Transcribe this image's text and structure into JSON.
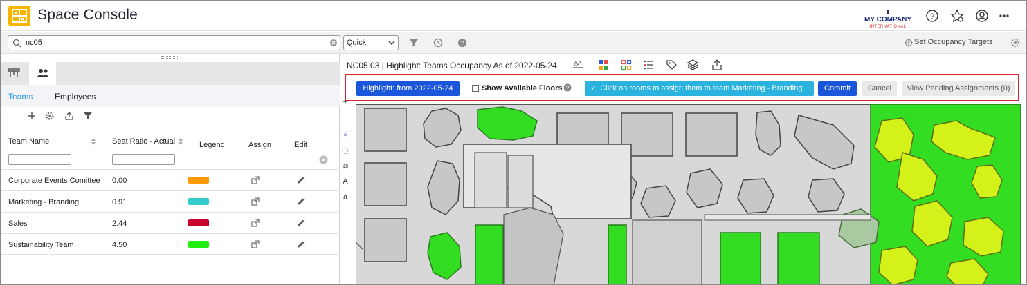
{
  "header": {
    "app_title": "Space Console",
    "company_name": "MY COMPANY",
    "company_sub": "INTERNATIONAL",
    "icons": [
      "help-icon",
      "star-settings-icon",
      "user-icon",
      "more-icon"
    ]
  },
  "toolbar": {
    "search_value": "nc05",
    "search_mode": "Quick",
    "occupancy_targets_label": "Set Occupancy Targets"
  },
  "left_panel": {
    "subtabs": [
      "Teams",
      "Employees"
    ],
    "columns": {
      "team_name": "Team Name",
      "seat_ratio": "Seat Ratio - Actual",
      "legend": "Legend",
      "assign": "Assign",
      "edit": "Edit"
    },
    "rows": [
      {
        "name": "Corporate Events Comittee",
        "ratio": "0.00",
        "color": "#ff9a00"
      },
      {
        "name": "Marketing - Branding",
        "ratio": "0.91",
        "color": "#33cccc"
      },
      {
        "name": "Sales",
        "ratio": "2.44",
        "color": "#c8002e"
      },
      {
        "name": "Sustainability Team",
        "ratio": "4.50",
        "color": "#22ee11"
      }
    ]
  },
  "right_panel": {
    "title": "NC05 03 | Highlight: Teams Occupancy As of 2022-05-24",
    "highlight_button": "Highlight: from 2022-05-24",
    "show_available_floors": "Show Available Floors",
    "assign_hint": "Click on rooms to assign them to team Marketing - Branding",
    "commit": "Commit",
    "cancel": "Cancel",
    "view_pending": "View Pending Assignments (0)"
  },
  "colors": {
    "accent_blue": "#1a56db",
    "hint_cyan": "#2bb3e0",
    "highlight_red": "#d9232d",
    "team_green": "#22ee11",
    "yellow_green": "#d4f21a"
  }
}
